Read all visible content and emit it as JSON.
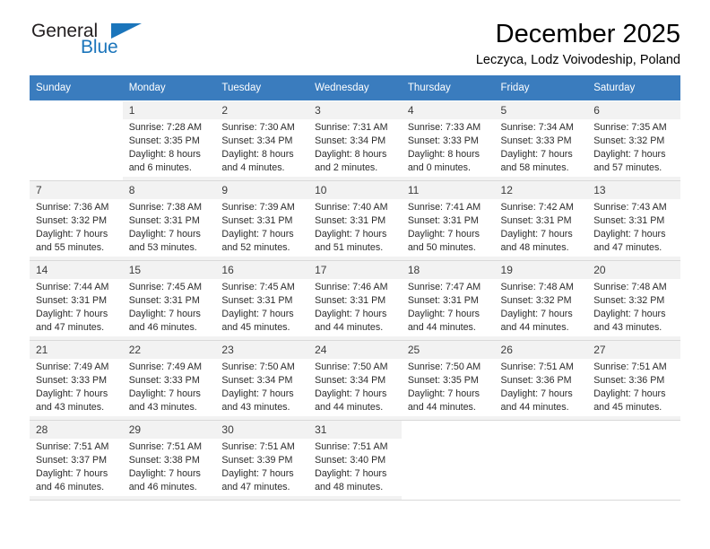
{
  "brand": {
    "name_top": "General",
    "name_bottom": "Blue",
    "color_primary": "#1b75bb",
    "color_text": "#231f20",
    "triangle_icon": "triangle-icon"
  },
  "header": {
    "title": "December 2025",
    "subtitle": "Leczyca, Lodz Voivodeship, Poland"
  },
  "calendar": {
    "header_bg": "#3a7cbe",
    "weekday_headers": [
      "Sunday",
      "Monday",
      "Tuesday",
      "Wednesday",
      "Thursday",
      "Friday",
      "Saturday"
    ],
    "weeks": [
      [
        {
          "day": "",
          "lines": []
        },
        {
          "day": "1",
          "lines": [
            "Sunrise: 7:28 AM",
            "Sunset: 3:35 PM",
            "Daylight: 8 hours",
            "and 6 minutes."
          ]
        },
        {
          "day": "2",
          "lines": [
            "Sunrise: 7:30 AM",
            "Sunset: 3:34 PM",
            "Daylight: 8 hours",
            "and 4 minutes."
          ]
        },
        {
          "day": "3",
          "lines": [
            "Sunrise: 7:31 AM",
            "Sunset: 3:34 PM",
            "Daylight: 8 hours",
            "and 2 minutes."
          ]
        },
        {
          "day": "4",
          "lines": [
            "Sunrise: 7:33 AM",
            "Sunset: 3:33 PM",
            "Daylight: 8 hours",
            "and 0 minutes."
          ]
        },
        {
          "day": "5",
          "lines": [
            "Sunrise: 7:34 AM",
            "Sunset: 3:33 PM",
            "Daylight: 7 hours",
            "and 58 minutes."
          ]
        },
        {
          "day": "6",
          "lines": [
            "Sunrise: 7:35 AM",
            "Sunset: 3:32 PM",
            "Daylight: 7 hours",
            "and 57 minutes."
          ]
        }
      ],
      [
        {
          "day": "7",
          "lines": [
            "Sunrise: 7:36 AM",
            "Sunset: 3:32 PM",
            "Daylight: 7 hours",
            "and 55 minutes."
          ]
        },
        {
          "day": "8",
          "lines": [
            "Sunrise: 7:38 AM",
            "Sunset: 3:31 PM",
            "Daylight: 7 hours",
            "and 53 minutes."
          ]
        },
        {
          "day": "9",
          "lines": [
            "Sunrise: 7:39 AM",
            "Sunset: 3:31 PM",
            "Daylight: 7 hours",
            "and 52 minutes."
          ]
        },
        {
          "day": "10",
          "lines": [
            "Sunrise: 7:40 AM",
            "Sunset: 3:31 PM",
            "Daylight: 7 hours",
            "and 51 minutes."
          ]
        },
        {
          "day": "11",
          "lines": [
            "Sunrise: 7:41 AM",
            "Sunset: 3:31 PM",
            "Daylight: 7 hours",
            "and 50 minutes."
          ]
        },
        {
          "day": "12",
          "lines": [
            "Sunrise: 7:42 AM",
            "Sunset: 3:31 PM",
            "Daylight: 7 hours",
            "and 48 minutes."
          ]
        },
        {
          "day": "13",
          "lines": [
            "Sunrise: 7:43 AM",
            "Sunset: 3:31 PM",
            "Daylight: 7 hours",
            "and 47 minutes."
          ]
        }
      ],
      [
        {
          "day": "14",
          "lines": [
            "Sunrise: 7:44 AM",
            "Sunset: 3:31 PM",
            "Daylight: 7 hours",
            "and 47 minutes."
          ]
        },
        {
          "day": "15",
          "lines": [
            "Sunrise: 7:45 AM",
            "Sunset: 3:31 PM",
            "Daylight: 7 hours",
            "and 46 minutes."
          ]
        },
        {
          "day": "16",
          "lines": [
            "Sunrise: 7:45 AM",
            "Sunset: 3:31 PM",
            "Daylight: 7 hours",
            "and 45 minutes."
          ]
        },
        {
          "day": "17",
          "lines": [
            "Sunrise: 7:46 AM",
            "Sunset: 3:31 PM",
            "Daylight: 7 hours",
            "and 44 minutes."
          ]
        },
        {
          "day": "18",
          "lines": [
            "Sunrise: 7:47 AM",
            "Sunset: 3:31 PM",
            "Daylight: 7 hours",
            "and 44 minutes."
          ]
        },
        {
          "day": "19",
          "lines": [
            "Sunrise: 7:48 AM",
            "Sunset: 3:32 PM",
            "Daylight: 7 hours",
            "and 44 minutes."
          ]
        },
        {
          "day": "20",
          "lines": [
            "Sunrise: 7:48 AM",
            "Sunset: 3:32 PM",
            "Daylight: 7 hours",
            "and 43 minutes."
          ]
        }
      ],
      [
        {
          "day": "21",
          "lines": [
            "Sunrise: 7:49 AM",
            "Sunset: 3:33 PM",
            "Daylight: 7 hours",
            "and 43 minutes."
          ]
        },
        {
          "day": "22",
          "lines": [
            "Sunrise: 7:49 AM",
            "Sunset: 3:33 PM",
            "Daylight: 7 hours",
            "and 43 minutes."
          ]
        },
        {
          "day": "23",
          "lines": [
            "Sunrise: 7:50 AM",
            "Sunset: 3:34 PM",
            "Daylight: 7 hours",
            "and 43 minutes."
          ]
        },
        {
          "day": "24",
          "lines": [
            "Sunrise: 7:50 AM",
            "Sunset: 3:34 PM",
            "Daylight: 7 hours",
            "and 44 minutes."
          ]
        },
        {
          "day": "25",
          "lines": [
            "Sunrise: 7:50 AM",
            "Sunset: 3:35 PM",
            "Daylight: 7 hours",
            "and 44 minutes."
          ]
        },
        {
          "day": "26",
          "lines": [
            "Sunrise: 7:51 AM",
            "Sunset: 3:36 PM",
            "Daylight: 7 hours",
            "and 44 minutes."
          ]
        },
        {
          "day": "27",
          "lines": [
            "Sunrise: 7:51 AM",
            "Sunset: 3:36 PM",
            "Daylight: 7 hours",
            "and 45 minutes."
          ]
        }
      ],
      [
        {
          "day": "28",
          "lines": [
            "Sunrise: 7:51 AM",
            "Sunset: 3:37 PM",
            "Daylight: 7 hours",
            "and 46 minutes."
          ]
        },
        {
          "day": "29",
          "lines": [
            "Sunrise: 7:51 AM",
            "Sunset: 3:38 PM",
            "Daylight: 7 hours",
            "and 46 minutes."
          ]
        },
        {
          "day": "30",
          "lines": [
            "Sunrise: 7:51 AM",
            "Sunset: 3:39 PM",
            "Daylight: 7 hours",
            "and 47 minutes."
          ]
        },
        {
          "day": "31",
          "lines": [
            "Sunrise: 7:51 AM",
            "Sunset: 3:40 PM",
            "Daylight: 7 hours",
            "and 48 minutes."
          ]
        },
        {
          "day": "",
          "lines": []
        },
        {
          "day": "",
          "lines": []
        },
        {
          "day": "",
          "lines": []
        }
      ]
    ]
  }
}
